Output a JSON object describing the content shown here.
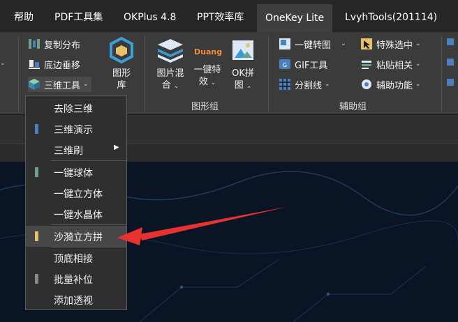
{
  "tabs": [
    "帮助",
    "PDF工具集",
    "OKPlus 4.8",
    "PPT效率库",
    "OneKey Lite",
    "LvyhTools(201114)"
  ],
  "ribbon": {
    "copy_distribute": "复制分布",
    "bottom_align": "底边垂移",
    "three_d_tools": "三维工具",
    "shape_lib_line1": "图形",
    "shape_lib_line2": "库",
    "pic_mix_line1": "图片混",
    "pic_mix_line2": "合",
    "one_key_fx_line1": "一键特",
    "one_key_fx_line2": "效",
    "duang_text": "Duang",
    "ok_puzzle_line1": "OK拼",
    "ok_puzzle_line2": "图",
    "one_key_convert": "一键转图",
    "gif_tool": "GIF工具",
    "split_line": "分割线",
    "special_select": "特殊选中",
    "paste_related": "粘贴相关",
    "aux_function": "辅助功能",
    "group_shape": "图形组",
    "group_aux": "辅助组"
  },
  "menu": {
    "items": [
      "去除三维",
      "三维演示",
      "三维刷",
      "一键球体",
      "一键立方体",
      "一键水晶体",
      "沙漪立方拼",
      "顶底相接",
      "批量补位",
      "添加透视"
    ]
  },
  "colors": {
    "accent_blue": "#4a7fc1",
    "accent_green": "#6aa38a",
    "accent_yellow": "#e8c06a",
    "accent_gray": "#8a8a8a",
    "arrow_red": "#e8322f"
  },
  "icons": [
    "copy-distribute-icon",
    "bottom-align-icon",
    "cube-icon",
    "hexagon-shape-icon",
    "mountain-layers-icon",
    "duang-icon",
    "image-icon",
    "convert-icon",
    "gif-icon",
    "grid-icon",
    "cursor-icon",
    "paste-icon",
    "helper-icon",
    "chevron-down-icon",
    "chevron-right-icon"
  ]
}
